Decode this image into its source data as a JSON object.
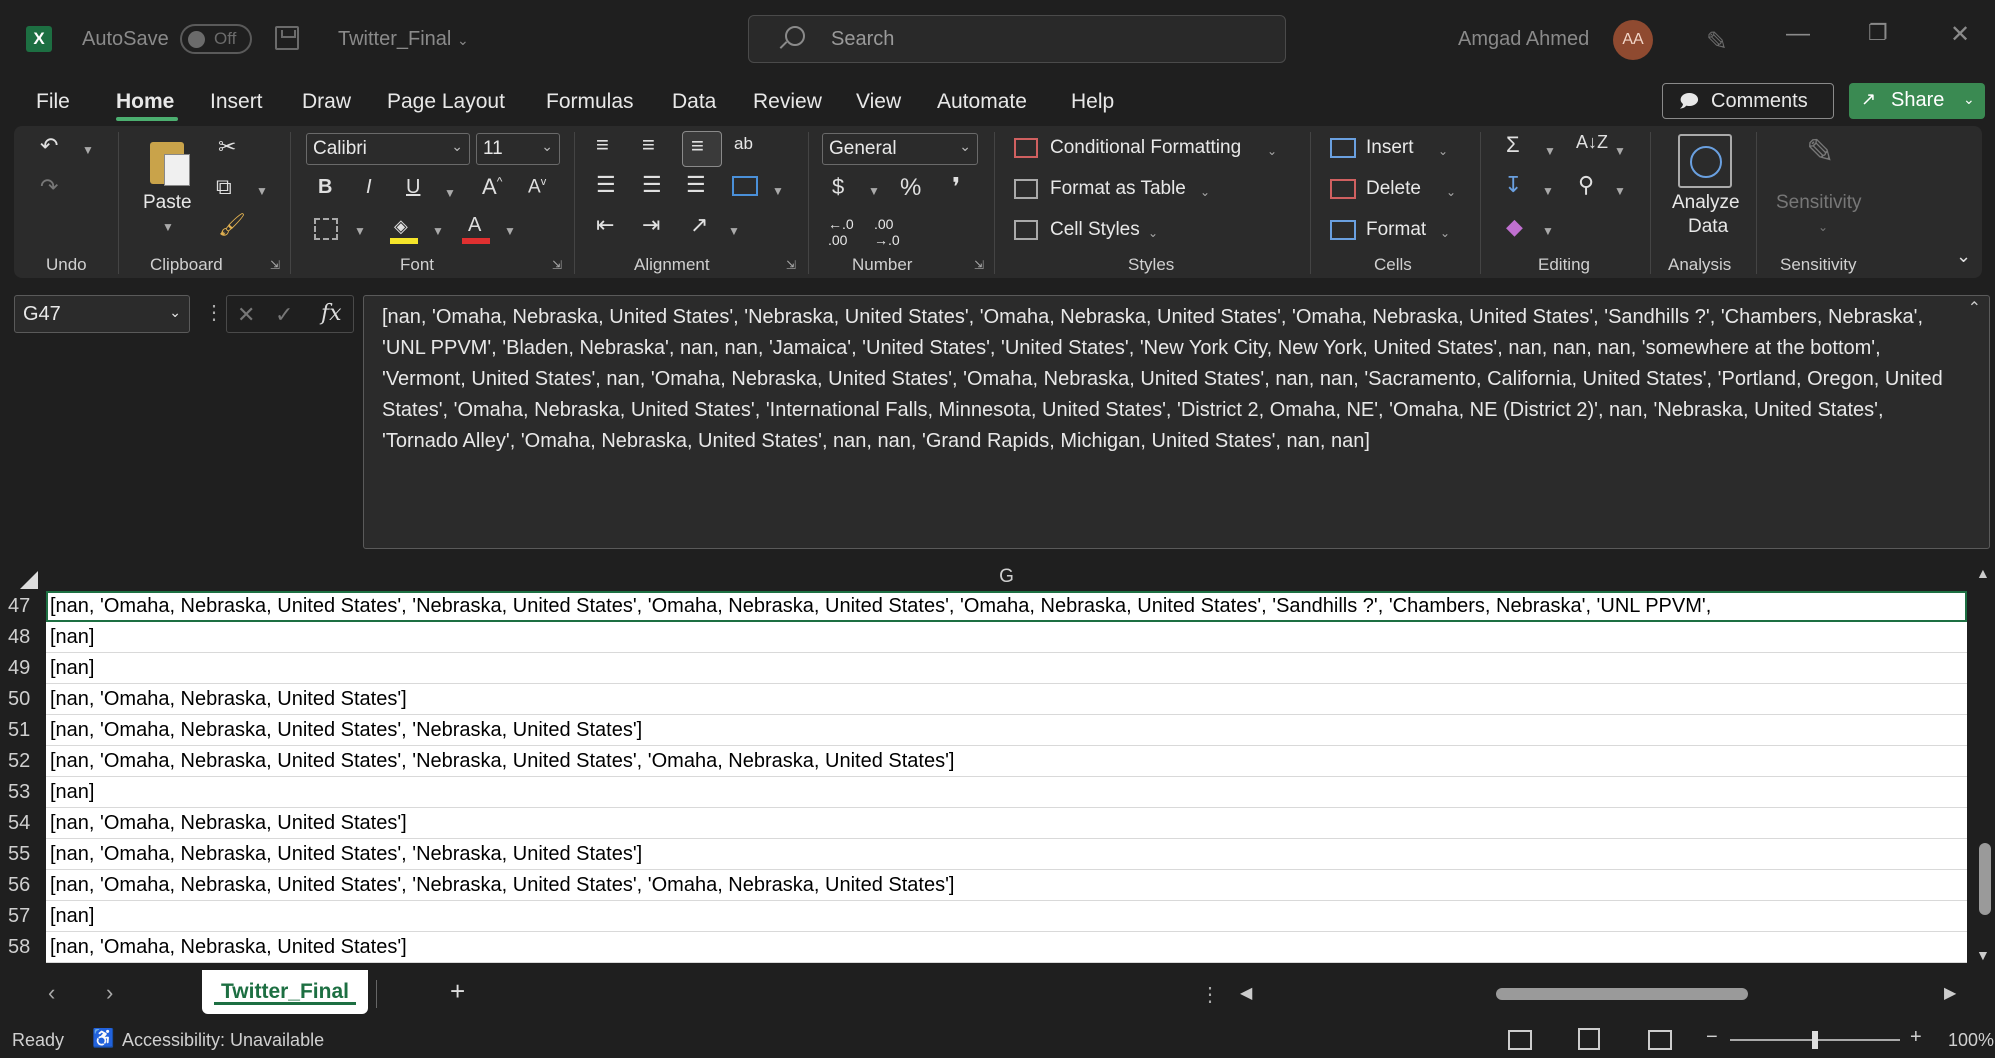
{
  "titlebar": {
    "app_letter": "X",
    "autosave_label": "AutoSave",
    "autosave_state": "Off",
    "filename": "Twitter_Final",
    "search_placeholder": "Search",
    "user_name": "Amgad Ahmed",
    "user_initials": "AA"
  },
  "menu": {
    "tabs": [
      "File",
      "Home",
      "Insert",
      "Draw",
      "Page Layout",
      "Formulas",
      "Data",
      "Review",
      "View",
      "Automate",
      "Help"
    ],
    "active": "Home",
    "comments_label": "Comments",
    "share_label": "Share"
  },
  "ribbon": {
    "groups": {
      "undo": "Undo",
      "clipboard": "Clipboard",
      "font": "Font",
      "alignment": "Alignment",
      "number": "Number",
      "styles": "Styles",
      "cells": "Cells",
      "editing": "Editing",
      "analysis": "Analysis",
      "sensitivity": "Sensitivity"
    },
    "paste_label": "Paste",
    "font_name": "Calibri",
    "font_size": "11",
    "number_format": "General",
    "conditional_formatting": "Conditional Formatting",
    "format_as_table": "Format as Table",
    "cell_styles": "Cell Styles",
    "insert": "Insert",
    "delete": "Delete",
    "format": "Format",
    "analyze_data_line1": "Analyze",
    "analyze_data_line2": "Data",
    "sensitivity_button": "Sensitivity"
  },
  "formula_bar": {
    "name_box": "G47",
    "fx": "fx",
    "content": "[nan, 'Omaha, Nebraska, United States', 'Nebraska, United States', 'Omaha, Nebraska, United States', 'Omaha, Nebraska, United States', 'Sandhills ?', 'Chambers, Nebraska', 'UNL PPVM', 'Bladen, Nebraska', nan, nan, 'Jamaica', 'United States', 'United States', 'New York City, New York, United States', nan, nan, nan, 'somewhere at the bottom', 'Vermont, United States', nan, 'Omaha, Nebraska, United States', 'Omaha, Nebraska, United States', nan, nan, 'Sacramento, California, United States', 'Portland, Oregon, United States', 'Omaha, Nebraska, United States', 'International Falls, Minnesota, United States', 'District 2, Omaha, NE', 'Omaha, NE (District 2)', nan, 'Nebraska, United States', 'Tornado Alley', 'Omaha, Nebraska, United States', nan, nan, 'Grand Rapids, Michigan, United States', nan, nan]"
  },
  "grid": {
    "column_header": "G",
    "rows": [
      {
        "num": "47",
        "value": "[nan, 'Omaha, Nebraska, United States', 'Nebraska, United States', 'Omaha, Nebraska, United States', 'Omaha, Nebraska, United States', 'Sandhills ?', 'Chambers, Nebraska', 'UNL PPVM',"
      },
      {
        "num": "48",
        "value": "[nan]"
      },
      {
        "num": "49",
        "value": "[nan]"
      },
      {
        "num": "50",
        "value": "[nan, 'Omaha, Nebraska, United States']"
      },
      {
        "num": "51",
        "value": "[nan, 'Omaha, Nebraska, United States', 'Nebraska, United States']"
      },
      {
        "num": "52",
        "value": "[nan, 'Omaha, Nebraska, United States', 'Nebraska, United States', 'Omaha, Nebraska, United States']"
      },
      {
        "num": "53",
        "value": "[nan]"
      },
      {
        "num": "54",
        "value": "[nan, 'Omaha, Nebraska, United States']"
      },
      {
        "num": "55",
        "value": "[nan, 'Omaha, Nebraska, United States', 'Nebraska, United States']"
      },
      {
        "num": "56",
        "value": "[nan, 'Omaha, Nebraska, United States', 'Nebraska, United States', 'Omaha, Nebraska, United States']"
      },
      {
        "num": "57",
        "value": "[nan]"
      },
      {
        "num": "58",
        "value": "[nan, 'Omaha, Nebraska, United States']"
      }
    ]
  },
  "sheets": {
    "active_tab": "Twitter_Final",
    "add_label": "+"
  },
  "status": {
    "ready": "Ready",
    "accessibility": "Accessibility: Unavailable",
    "zoom": "100%"
  },
  "colors": {
    "excel_green": "#1d6f42",
    "share_green": "#3a8a52",
    "background": "#1f1f1f",
    "ribbon": "#2b2b2b"
  }
}
